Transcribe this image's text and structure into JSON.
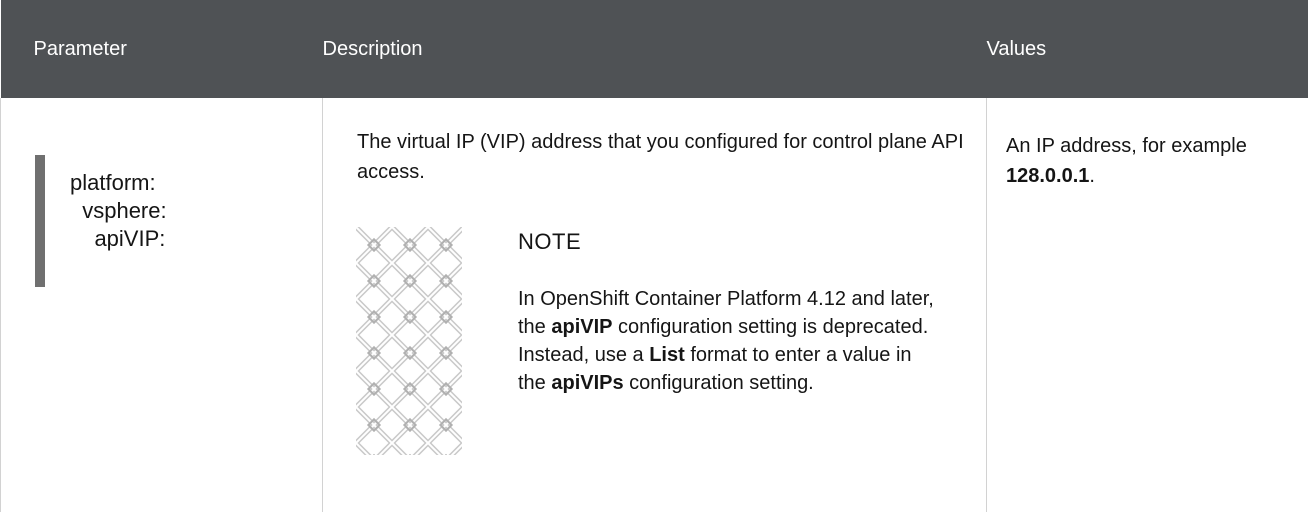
{
  "table": {
    "headers": [
      "Parameter",
      "Description",
      "Values"
    ],
    "row": {
      "parameter": "platform:\n  vsphere:\n    apiVIP:",
      "description": "The virtual IP (VIP) address that you configured for control plane API access.",
      "note": {
        "title": "NOTE",
        "body_parts": [
          "In OpenShift Container Platform 4.12 and later, the ",
          "apiVIP",
          " configuration setting is deprecated. Instead, use a ",
          "List",
          " format to enter a value in the ",
          "apiVIPs",
          " configuration setting."
        ]
      },
      "values": {
        "prefix": "An IP address, for example ",
        "example": "128.0.0.1",
        "suffix": "."
      }
    }
  },
  "icons": {
    "note": "note-pattern-icon"
  }
}
